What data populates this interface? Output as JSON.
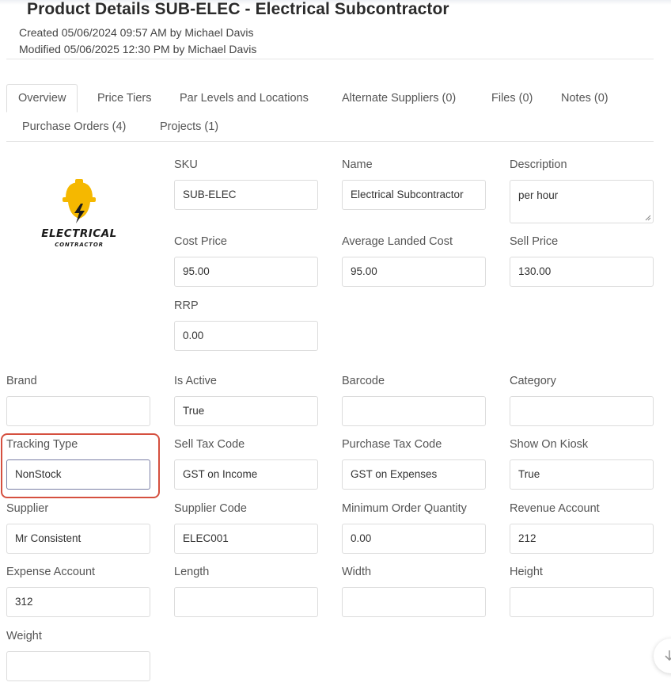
{
  "header": {
    "title": "Product Details SUB-ELEC - Electrical Subcontractor",
    "created": "Created 05/06/2024 09:57 AM by Michael Davis",
    "modified": "Modified 05/06/2025 12:30 PM by Michael Davis"
  },
  "tabs": [
    {
      "label": "Overview",
      "active": true
    },
    {
      "label": "Price Tiers"
    },
    {
      "label": "Par Levels and Locations"
    },
    {
      "label": "Alternate Suppliers (0)"
    },
    {
      "label": "Files (0)"
    },
    {
      "label": "Notes (0)"
    },
    {
      "label": "Purchase Orders (4)"
    },
    {
      "label": "Projects (1)"
    }
  ],
  "logo": {
    "line1": "ELECTRICAL",
    "line2": "CONTRACTOR",
    "colors": {
      "helmet": "#f5b800",
      "text": "#1b1b1b"
    }
  },
  "fields": {
    "sku": {
      "label": "SKU",
      "value": "SUB-ELEC"
    },
    "name": {
      "label": "Name",
      "value": "Electrical Subcontractor"
    },
    "description": {
      "label": "Description",
      "value": "per hour"
    },
    "cost_price": {
      "label": "Cost Price",
      "value": "95.00"
    },
    "avg_landed_cost": {
      "label": "Average Landed Cost",
      "value": "95.00"
    },
    "sell_price": {
      "label": "Sell Price",
      "value": "130.00"
    },
    "rrp": {
      "label": "RRP",
      "value": "0.00"
    },
    "brand": {
      "label": "Brand",
      "value": ""
    },
    "is_active": {
      "label": "Is Active",
      "value": "True"
    },
    "barcode": {
      "label": "Barcode",
      "value": ""
    },
    "category": {
      "label": "Category",
      "value": ""
    },
    "tracking_type": {
      "label": "Tracking Type",
      "value": "NonStock"
    },
    "sell_tax_code": {
      "label": "Sell Tax Code",
      "value": "GST on Income"
    },
    "purchase_tax_code": {
      "label": "Purchase Tax Code",
      "value": "GST on Expenses"
    },
    "show_on_kiosk": {
      "label": "Show On Kiosk",
      "value": "True"
    },
    "supplier": {
      "label": "Supplier",
      "value": "Mr Consistent"
    },
    "supplier_code": {
      "label": "Supplier Code",
      "value": "ELEC001"
    },
    "min_order_qty": {
      "label": "Minimum Order Quantity",
      "value": "0.00"
    },
    "revenue_account": {
      "label": "Revenue Account",
      "value": "212"
    },
    "expense_account": {
      "label": "Expense Account",
      "value": "312"
    },
    "length": {
      "label": "Length",
      "value": ""
    },
    "width": {
      "label": "Width",
      "value": ""
    },
    "height": {
      "label": "Height",
      "value": ""
    },
    "weight": {
      "label": "Weight",
      "value": ""
    }
  },
  "highlight_color": "#d5503f"
}
